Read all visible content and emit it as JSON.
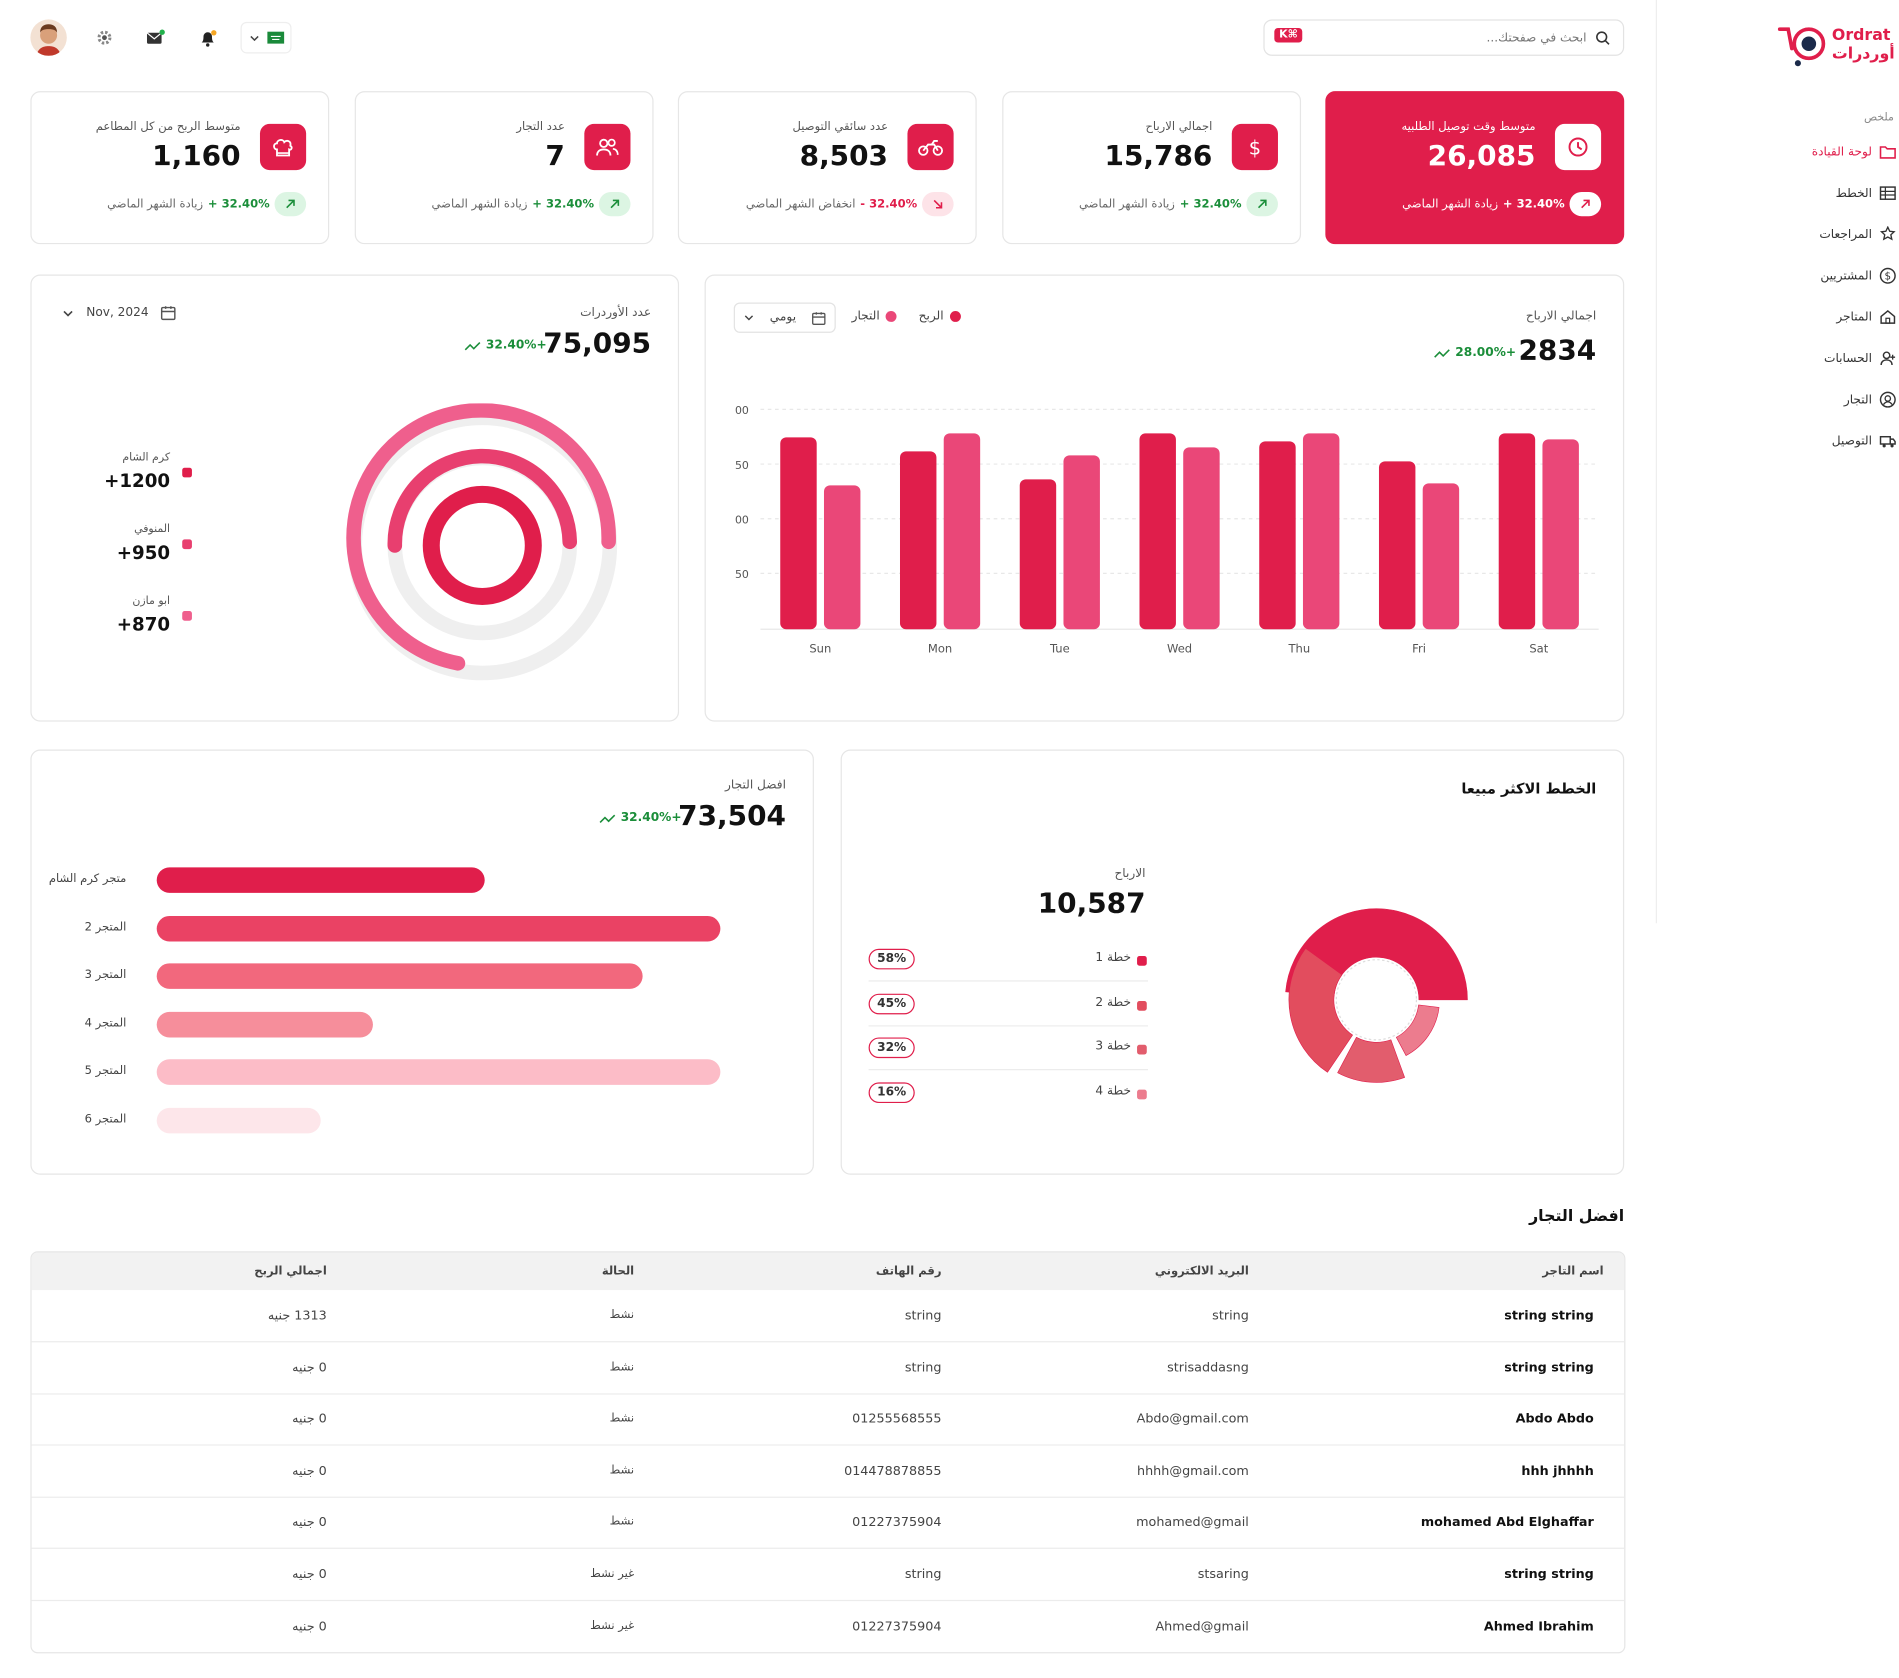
{
  "brand": {
    "name_en": "Ordrat",
    "name_ar": "أوردرات",
    "accent": "#e01e4b"
  },
  "search": {
    "placeholder": "ابحث في صفحتك...",
    "shortcut": "K⌘"
  },
  "sidebar": {
    "section": "ملخص",
    "items": [
      {
        "label": "لوحة القيادة",
        "icon": "folder-icon",
        "active": true
      },
      {
        "label": "الخطط",
        "icon": "table-icon"
      },
      {
        "label": "المراجعات",
        "icon": "star-pen-icon"
      },
      {
        "label": "المشتريين",
        "icon": "dollar-circle-icon"
      },
      {
        "label": "المتاجر",
        "icon": "store-icon"
      },
      {
        "label": "الحسابات",
        "icon": "user-plus-icon"
      },
      {
        "label": "التجار",
        "icon": "user-circle-icon"
      },
      {
        "label": "التوصيل",
        "icon": "truck-icon"
      }
    ]
  },
  "stats": [
    {
      "title": "متوسط وقت توصيل الطلبيه",
      "value": "26,085",
      "change": "+ 32.40%",
      "note": "زيادة الشهر الماضي",
      "trend": "up",
      "highlight": true,
      "icon": "clock-icon"
    },
    {
      "title": "اجمالي الارباح",
      "value": "15,786",
      "change": "+ 32.40%",
      "note": "زيادة الشهر الماضي",
      "trend": "up",
      "icon": "dollar-icon"
    },
    {
      "title": "عدد سائقي التوصيل",
      "value": "8,503",
      "change": "- 32.40%",
      "note": "انخفاض الشهر الماضي",
      "trend": "down",
      "icon": "motorbike-icon"
    },
    {
      "title": "عدد التجار",
      "value": "7",
      "change": "+ 32.40%",
      "note": "زيادة الشهر الماضي",
      "trend": "up",
      "icon": "users-icon"
    },
    {
      "title": "متوسط الربح من كل المطاعم",
      "value": "1,160",
      "change": "+ 32.40%",
      "note": "زيادة الشهر الماضي",
      "trend": "up",
      "icon": "chef-hat-icon"
    }
  ],
  "orders_card": {
    "title": "عدد الأوردرات",
    "value": "75,095",
    "change": "32.40%+",
    "date": "Nov, 2024",
    "legend": [
      {
        "name": "كرم الشام",
        "value": "+1200"
      },
      {
        "name": "المنوفي",
        "value": "+950"
      },
      {
        "name": "ابو مازن",
        "value": "+870"
      }
    ]
  },
  "profit_card": {
    "title": "اجمالي الارباح",
    "value": "2834",
    "change": "28.00%+",
    "period": "يومي",
    "legend": [
      "الربح",
      "التجار"
    ]
  },
  "chart_data": [
    {
      "type": "bar",
      "categories": [
        "Sun",
        "Mon",
        "Tue",
        "Wed",
        "Thu",
        "Fri",
        "Sat"
      ],
      "series": [
        {
          "name": "الربح",
          "values": [
            96,
            89,
            75,
            98,
            94,
            84,
            98
          ]
        },
        {
          "name": "التجار",
          "values": [
            72,
            98,
            87,
            91,
            98,
            73,
            95
          ]
        }
      ],
      "ylim": [
        0,
        110
      ],
      "yticks": [
        "00",
        "50",
        "00",
        "50"
      ]
    },
    {
      "type": "pie",
      "title": "الخطط الاكثر مبيعا",
      "categories": [
        "خطة 1",
        "خطة 2",
        "خطة 3",
        "خطة 4"
      ],
      "values": [
        58,
        45,
        32,
        16
      ]
    },
    {
      "type": "bar",
      "orientation": "horizontal",
      "title": "افضل التجار",
      "categories": [
        "متجر كرم الشام",
        "المتجر 2",
        "المتجر 3",
        "المتجر 4",
        "المتجر 5",
        "المتجر 6"
      ],
      "values": [
        50,
        86,
        74,
        33,
        86,
        25
      ],
      "xlim": [
        0,
        100
      ]
    }
  ],
  "plans_card": {
    "title": "الخطط الاكثر مبيعا",
    "metric_label": "الارباح",
    "metric_value": "10,587",
    "rows": [
      {
        "name": "خطة 1",
        "pct": "58%"
      },
      {
        "name": "خطة 2",
        "pct": "45%"
      },
      {
        "name": "خطة 3",
        "pct": "32%"
      },
      {
        "name": "خطة 4",
        "pct": "16%"
      }
    ]
  },
  "merchants_card": {
    "title": "افضل التجار",
    "value": "73,504",
    "change": "32.40%+"
  },
  "table": {
    "title": "افضل التجار",
    "headers": [
      "اسم التاجر",
      "البريد الالكتروني",
      "رقم الهاتف",
      "الحالة",
      "اجمالي الربح"
    ],
    "rows": [
      [
        "string string",
        "string",
        "string",
        "نشط",
        "1313 جنيه"
      ],
      [
        "string string",
        "strisaddasng",
        "string",
        "نشط",
        "0 جنيه"
      ],
      [
        "Abdo Abdo",
        "Abdo@gmail.com",
        "01255568555",
        "نشط",
        "0 جنيه"
      ],
      [
        "hhh jhhhh",
        "hhhh@gmail.com",
        "014478878855",
        "نشط",
        "0 جنيه"
      ],
      [
        "mohamed Abd Elghaffar",
        "mohamed@gmail",
        "01227375904",
        "نشط",
        "0 جنيه"
      ],
      [
        "string string",
        "stsaring",
        "string",
        "غير نشط",
        "0 جنيه"
      ],
      [
        "Ahmed Ibrahim",
        "Ahmed@gmail",
        "01227375904",
        "غير نشط",
        "0 جنيه"
      ]
    ]
  }
}
